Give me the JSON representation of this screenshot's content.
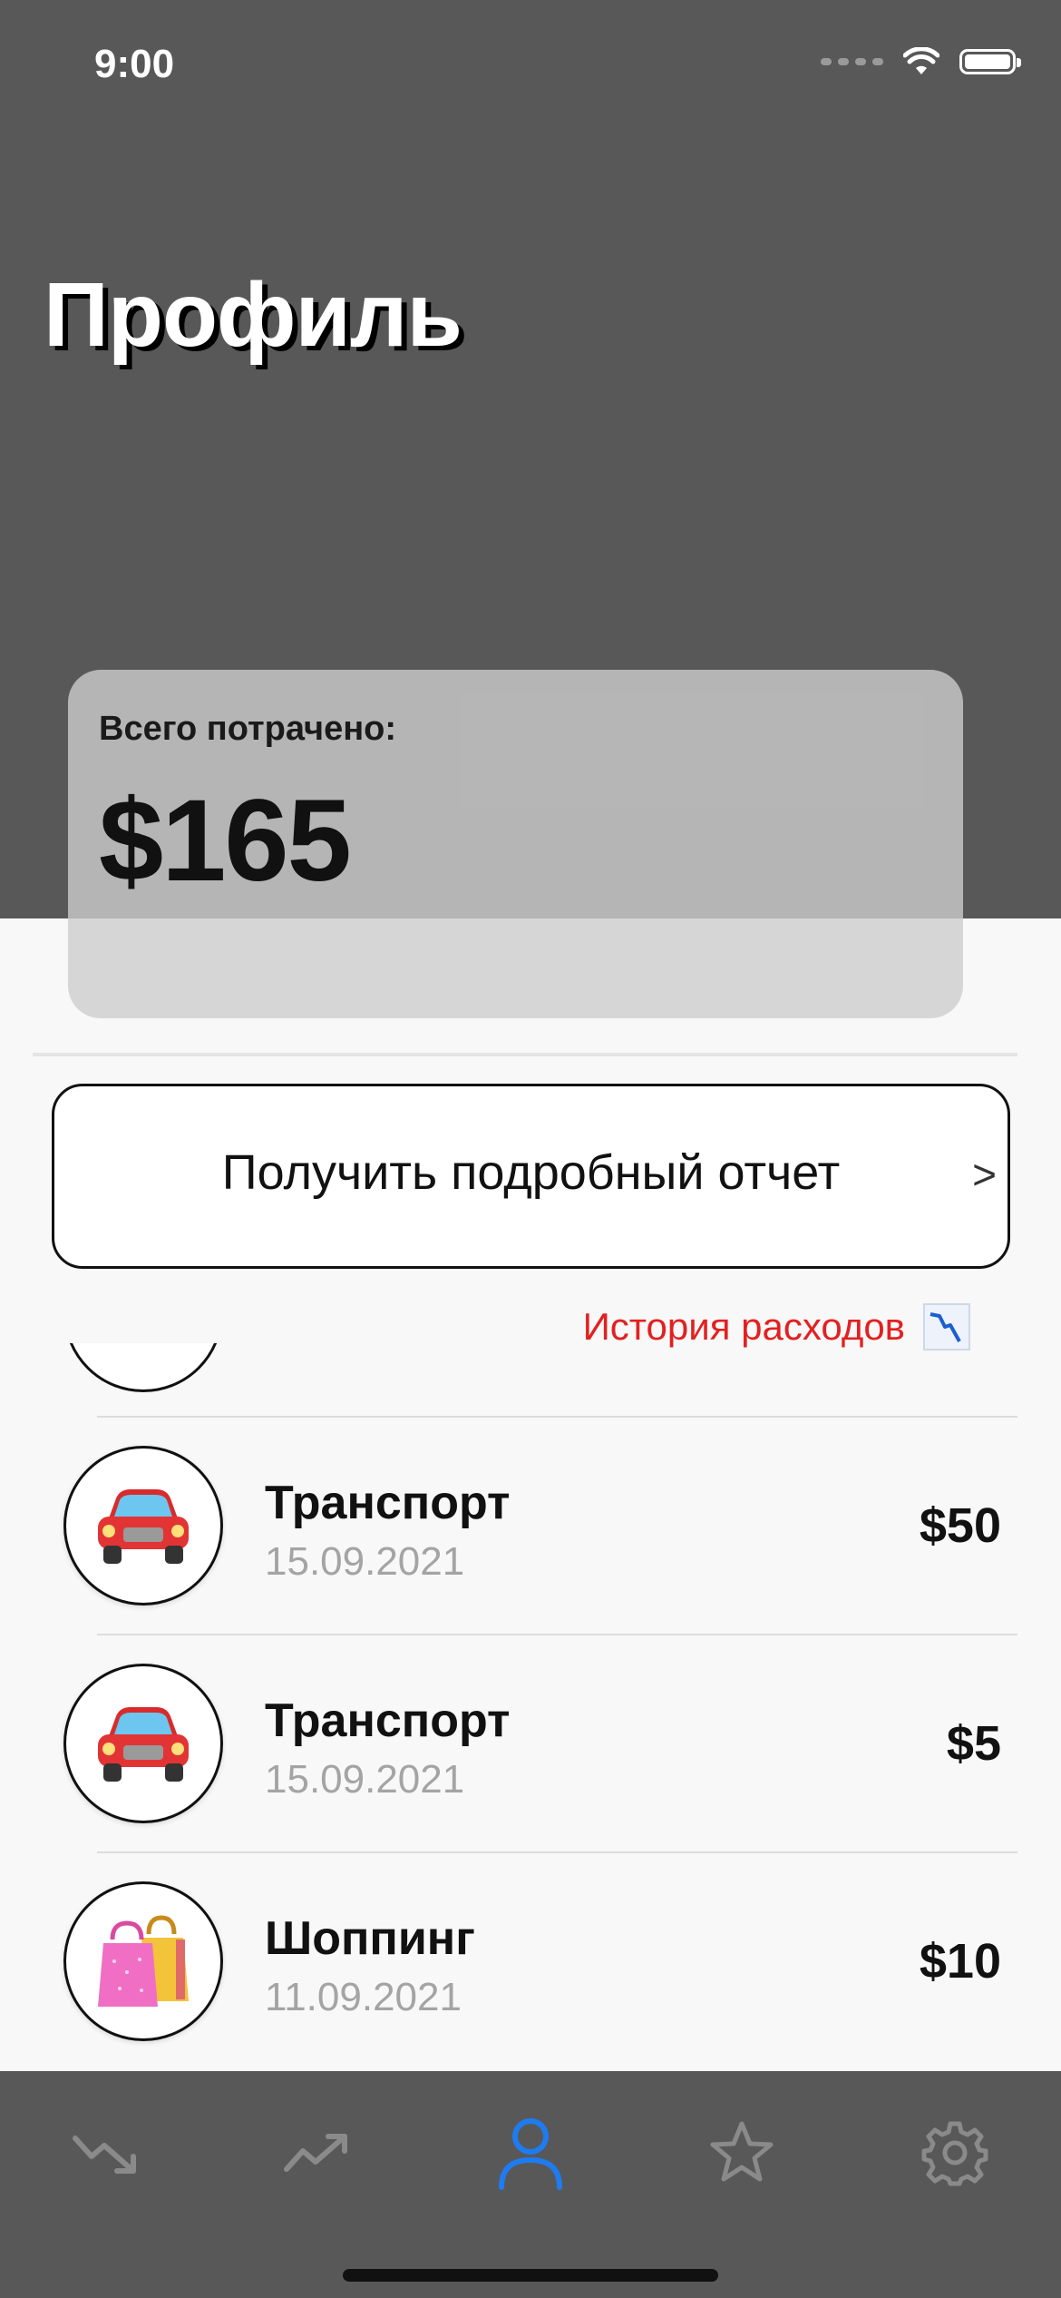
{
  "status_bar": {
    "time": "9:00"
  },
  "header": {
    "title": "Профиль"
  },
  "summary": {
    "label": "Всего потрачено:",
    "amount": "$165"
  },
  "report_button": {
    "label": "Получить подробный отчет",
    "chevron": ">"
  },
  "history": {
    "label": "История расходов",
    "icon": "chart-decreasing-icon"
  },
  "transactions": [
    {
      "category": "Транспорт",
      "date": "15.09.2021",
      "amount": "$50",
      "icon": "car-icon"
    },
    {
      "category": "Транспорт",
      "date": "15.09.2021",
      "amount": "$5",
      "icon": "car-icon"
    },
    {
      "category": "Шоппинг",
      "date": "11.09.2021",
      "amount": "$10",
      "icon": "shopping-bags-icon"
    }
  ],
  "tab_bar": {
    "tabs": [
      {
        "name": "expenses-trend-down-icon",
        "active": false
      },
      {
        "name": "income-trend-up-icon",
        "active": false
      },
      {
        "name": "profile-icon",
        "active": true
      },
      {
        "name": "favorites-star-icon",
        "active": false
      },
      {
        "name": "settings-gear-icon",
        "active": false
      }
    ],
    "active_color": "#1e7cf2",
    "inactive_color": "#8a8a8a"
  },
  "colors": {
    "header_bg": "#585858",
    "history_link": "#e32020",
    "content_bg": "#f8f8f8"
  }
}
